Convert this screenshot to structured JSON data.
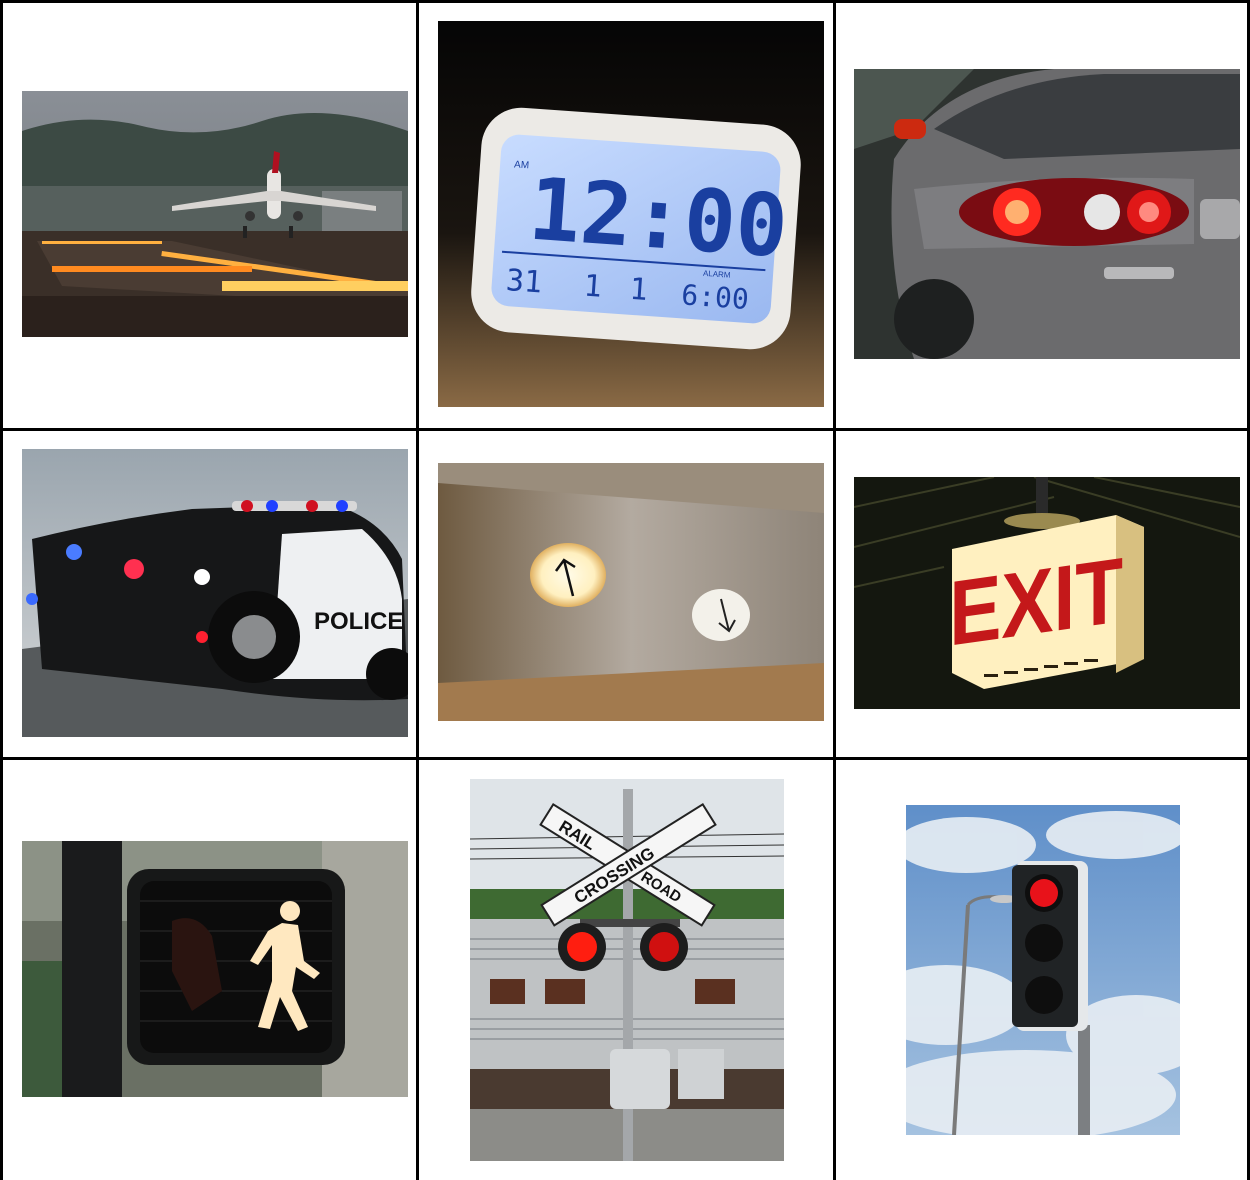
{
  "grid": {
    "rows": 3,
    "columns": 3,
    "border_color": "#000000",
    "background": "#ffffff"
  },
  "cells": [
    {
      "subject": "airplane-landing-runway-lights"
    },
    {
      "subject": "digital-alarm-clock",
      "clock": {
        "am_label": "AM",
        "time": "12:00",
        "temp": "31",
        "month": "1",
        "day": "1",
        "alarm_label": "ALARM",
        "alarm_time": "6:00"
      }
    },
    {
      "subject": "car-tail-light"
    },
    {
      "subject": "police-car",
      "car_text": "POLICE"
    },
    {
      "subject": "elevator-up-down-buttons"
    },
    {
      "subject": "exit-sign",
      "sign_text": "EXIT"
    },
    {
      "subject": "pedestrian-walk-signal"
    },
    {
      "subject": "railroad-crossing-signal",
      "sign": {
        "left_text": "RAIL",
        "right_text": "ROAD",
        "cross_text": "CROSSING"
      }
    },
    {
      "subject": "red-traffic-light"
    }
  ]
}
